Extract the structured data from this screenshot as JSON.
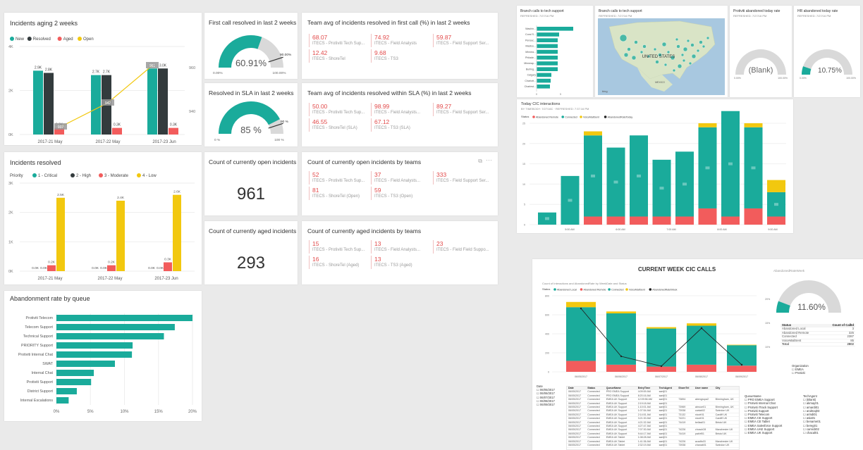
{
  "colors": {
    "teal": "#1aab9b",
    "dark": "#333b3d",
    "red": "#f25c5c",
    "yellow": "#f2c80f",
    "gaugeGrey": "#d9d9d9"
  },
  "aging": {
    "title": "Incidents aging 2 weeks",
    "legend": [
      "New",
      "Resolved",
      "Aged",
      "Open"
    ],
    "categories": [
      "2017-21 May",
      "2017-22 May",
      "2017-23 Jun"
    ],
    "y_ticks": [
      "4K",
      "2K",
      "0K"
    ],
    "y2_ticks": [
      "960",
      "940"
    ],
    "labels": {
      "new": [
        "2.9K",
        "2.7K",
        "3.0K"
      ],
      "resolved": [
        "2.8K",
        "2.7K",
        "3.0K"
      ],
      "aged": [
        "0.3K",
        "0.3K",
        "0.3K"
      ],
      "open": [
        "937",
        "942",
        "961"
      ]
    }
  },
  "resolved": {
    "title": "Incidents resolved",
    "legend_title": "Priority",
    "legend": [
      "1 - Critical",
      "2 - High",
      "3 - Moderate",
      "4 - Low"
    ],
    "categories": [
      "2017-21 May",
      "2017-22 May",
      "2017-23 Jun"
    ],
    "y_ticks": [
      "3K",
      "2K",
      "1K",
      "0K"
    ],
    "labels": {
      "critical": [
        "0.0K",
        "0.0K",
        "0.0K"
      ],
      "high": [
        "0.0K",
        "0.0K",
        "0.0K"
      ],
      "moderate": [
        "0.2K",
        "0.2K",
        "0.3K"
      ],
      "low": [
        "2.5K",
        "2.4K",
        "2.6K"
      ]
    }
  },
  "abandon": {
    "title": "Abandonment rate by queue",
    "x_ticks": [
      "0%",
      "5%",
      "10%",
      "15%",
      "20%"
    ]
  },
  "fcr": {
    "title": "First call resolved in last 2 weeks",
    "value": "60.91%",
    "min": "0.00%",
    "max": "100.00%",
    "target": "90.00%"
  },
  "sla": {
    "title": "Resolved in SLA in last 2 weeks",
    "value": "85 %",
    "min": "0 %",
    "max": "100 %",
    "target": "90 %"
  },
  "open_count": {
    "title": "Count of currently open incidents",
    "value": "961"
  },
  "aged_count": {
    "title": "Count of currently aged incidents",
    "value": "293"
  },
  "team_fcr": {
    "title": "Team avg of incidents resolved in first call (%) in last 2 weeks",
    "rows": [
      [
        {
          "v": "68.07",
          "l": "ITECS - Protiviti Tech Sup..."
        },
        {
          "v": "74.92",
          "l": "ITECS - Field Analysts"
        },
        {
          "v": "59.87",
          "l": "ITECS - Field Support Ser..."
        }
      ],
      [
        {
          "v": "12.42",
          "l": "ITECS - ShoreTel"
        },
        {
          "v": "9.68",
          "l": "ITECS - TS3"
        }
      ]
    ]
  },
  "team_sla": {
    "title": "Team avg of incidents resolved within SLA (%) in last 2 weeks",
    "rows": [
      [
        {
          "v": "50.00",
          "l": "ITECS - Protiviti Tech Sup..."
        },
        {
          "v": "98.99",
          "l": "ITECS - Field Analysts..."
        },
        {
          "v": "89.27",
          "l": "ITECS - Field Support Ser..."
        }
      ],
      [
        {
          "v": "46.55",
          "l": "ITECS - ShoreTel (SLA)"
        },
        {
          "v": "67.12",
          "l": "ITECS - TS3 (SLA)"
        }
      ]
    ]
  },
  "team_open": {
    "title": "Count of currently open incidents by teams",
    "rows": [
      [
        {
          "v": "52",
          "l": "ITECS - Protiviti Tech Sup..."
        },
        {
          "v": "37",
          "l": "ITECS - Field Analysts..."
        },
        {
          "v": "333",
          "l": "ITECS - Field Support Ser..."
        }
      ],
      [
        {
          "v": "81",
          "l": "ITECS - ShoreTel (Open)"
        },
        {
          "v": "59",
          "l": "ITECS - TS3 (Open)"
        }
      ]
    ]
  },
  "team_aged": {
    "title": "Count of currently aged incidents by teams",
    "rows": [
      [
        {
          "v": "15",
          "l": "ITECS - Protiviti Tech Sup..."
        },
        {
          "v": "13",
          "l": "ITECS - Field Analysts..."
        },
        {
          "v": "23",
          "l": "ITECS - Field Field Suppo..."
        }
      ],
      [
        {
          "v": "16",
          "l": "ITECS - ShoreTel (Aged)"
        },
        {
          "v": "13",
          "l": "ITECS - TS3 (Aged)"
        }
      ]
    ]
  },
  "branch": {
    "title": "Branch calls to tech support",
    "sub": "REFRESHED: 7/27/16 PM",
    "items": [
      "Washin...",
      "Coral S...",
      "Pensac...",
      "Madiso...",
      "Minnea...",
      "Philade...",
      "Minneap...",
      "Burling...",
      "Calgary",
      "Charlott...",
      "Charlest..."
    ],
    "x_ticks": [
      "0",
      "5"
    ]
  },
  "map": {
    "title": "Branch calls to tech support",
    "sub": "REFRESHED: 7/27/16 PM",
    "country": "UNITED STATES",
    "mexico": "MEXICO",
    "brand": "bing"
  },
  "pab": {
    "title": "Protiviti abandoned today rate",
    "sub": "REFRESHED: 7/27/16 PM",
    "value": "(Blank)",
    "min": "0.00%",
    "max": "100.00%"
  },
  "hr": {
    "title": "HR abandoned today rate",
    "sub": "REFRESHED: 7/27/16 PM",
    "value": "10.75%",
    "min": "0.00%",
    "max": "100.00%"
  },
  "cic": {
    "title": "Today CIC interactions",
    "sub": "BY TIMEBODY: 7/27/16C  ·  REFRESHED: 7:37:16 PM",
    "legend_title": "Status",
    "legend": [
      "Abandoned Remote",
      "Connected",
      "VoiceMailSent",
      "AbandonedRateToday"
    ],
    "y_ticks": [
      "25",
      "20",
      "15",
      "10",
      "5",
      "0"
    ],
    "x_labels": [
      "5:00 AM",
      "6:00 AM",
      "7:00 AM",
      "8:00 AM",
      "9:00 AM"
    ]
  },
  "week": {
    "title": "CURRENT WEEK CIC CALLS",
    "legend_title": "Status",
    "sub": "Count of Interactions and AbandonedRate by WeekDate and Status",
    "legend": [
      "Abandoned Local",
      "Abandoned Remote",
      "Connected",
      "VoiceMailSent",
      "AbandonedRateWeek"
    ],
    "y_ticks": [
      "800",
      "600",
      "400",
      "200",
      "0"
    ],
    "y2_ticks": [
      "20%",
      "15%",
      "10%"
    ],
    "dates": [
      "06/05/2017",
      "06/06/2017",
      "06/07/2017",
      "06/08/2017",
      "06/09/2017"
    ],
    "gauge_title": "AbandonedRateWeek",
    "gauge_value": "11.60%",
    "status_header": [
      "Status",
      "Count of CallId"
    ],
    "status_rows": [
      [
        "Abandoned Local",
        "3"
      ],
      [
        "Abandoned Remote",
        "325"
      ],
      [
        "Connected",
        "2387"
      ],
      [
        "VoiceMailSent",
        "85"
      ],
      [
        "Total",
        "2802"
      ]
    ],
    "org_title": "Organization",
    "orgs": [
      "EMEA",
      "Protiviti"
    ],
    "date_title": "Date",
    "date_items": [
      "06/05/2017",
      "06/06/2017",
      "06/07/2017",
      "06/08/2017",
      "06/09/2017"
    ],
    "grid_header": [
      "Date",
      "Status",
      "QueueName",
      "EntryTime",
      "TechAgent",
      "ShoreTel",
      "User name",
      "City"
    ],
    "grid_rows": [
      [
        "06/05/2017",
        "Connected",
        "PRO EMEA Support",
        "4:09:59 AM",
        "sanfj01",
        "",
        "",
        ""
      ],
      [
        "06/05/2017",
        "Connected",
        "PRO EMEA Support",
        "8:20:16 AM",
        "sanfj01",
        "",
        "",
        ""
      ],
      [
        "06/05/2017",
        "Connected",
        "EMEA UK Support",
        "12:09:56 AM",
        "sanfj01",
        "73894",
        "abengrupa2",
        "Birmingham, UK"
      ],
      [
        "06/05/2017",
        "Connected",
        "EMEA UK Support",
        "2:19:18 AM",
        "sanfj01",
        "",
        "",
        ""
      ],
      [
        "06/05/2017",
        "Connected",
        "EMEA UK Support",
        "1:10:01 AM",
        "sanfj01",
        "73969",
        "abrooe01",
        "Birmingham, UK"
      ],
      [
        "06/05/2017",
        "Connected",
        "EMEA UK Support",
        "1:07:54 AM",
        "sanfj01",
        "73938",
        "cartab02",
        "Swindon UK"
      ],
      [
        "06/05/2017",
        "Connected",
        "EMEA UK Support",
        "2:14:51 AM",
        "sanfj01",
        "73132",
        "nicofr01",
        "Cardiff UK"
      ],
      [
        "06/05/2017",
        "Connected",
        "EMEA UK Support",
        "3:21:30 AM",
        "sanfj01",
        "74221",
        "nicofr01",
        "Cardiff UK"
      ],
      [
        "06/05/2017",
        "Connected",
        "EMEA UK Support",
        "4:21:32 AM",
        "sanfj01",
        "74419",
        "bellasi01",
        "Bristol UK"
      ],
      [
        "06/05/2017",
        "Connected",
        "EMEA UK Support",
        "4:27:47 AM",
        "sanfj01",
        "",
        "",
        ""
      ],
      [
        "06/05/2017",
        "Connected",
        "EMEA UK Support",
        "7:07:30 AM",
        "sanfj01",
        "74226",
        "chosch28",
        "Manchester UK"
      ],
      [
        "06/05/2017",
        "Connected",
        "EMEA UK Support",
        "9:44:17 AM",
        "sanfj01",
        "74419",
        "pabirf01",
        "Bristol UK"
      ],
      [
        "06/05/2017",
        "Connected",
        "EMEA UK Tablet",
        "1:08:28 AM",
        "sanfj01",
        "",
        "",
        ""
      ],
      [
        "06/05/2017",
        "Connected",
        "EMEA UK Tablet",
        "1:41:36 AM",
        "sanfj01",
        "74226",
        "acadfo03",
        "Manchester UK"
      ],
      [
        "06/05/2017",
        "Connected",
        "EMEA UK Tablet",
        "2:32:19 AM",
        "sanfj01",
        "73938",
        "chanab01",
        "Swindon UK"
      ]
    ],
    "queue_title": "QueueName",
    "queues": [
      "PRO EMEA Support",
      "Protiviti Internal Chat",
      "Protiviti iTrack Support",
      "Protiviti Support",
      "Protiviti Telecom",
      "EMEA CE Support",
      "EMEA CE Tablet",
      "EMEA Salesforce Support",
      "EMEA UAE Support",
      "EMEA UK Support"
    ],
    "agent_title": "TechAgent",
    "agents": [
      "(Blank)",
      "akmay01",
      "amardi01",
      "andmaj03",
      "arindi01",
      "asia01",
      "benarne01",
      "bereg01",
      "camicb02",
      "chacal01"
    ]
  }
}
